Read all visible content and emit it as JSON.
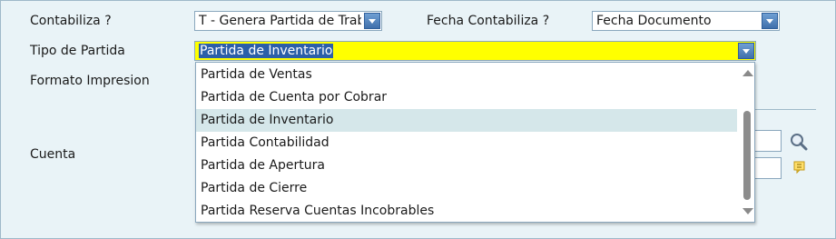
{
  "form": {
    "contabiliza_label": "Contabiliza ?",
    "contabiliza_value": "T - Genera Partida de Traba",
    "fecha_contabiliza_label": "Fecha Contabiliza ?",
    "fecha_contabiliza_value": "Fecha Documento",
    "tipo_partida_label": "Tipo de Partida",
    "tipo_partida_value": "Partida de Inventario",
    "formato_impresion_label": "Formato Impresion",
    "cuenta_label": "Cuenta"
  },
  "dropdown": {
    "selected_index": 2,
    "options": [
      "Partida de Ventas",
      "Partida de Cuenta por Cobrar",
      "Partida de Inventario",
      "Partida Contabilidad",
      "Partida de Apertura",
      "Partida de Cierre",
      "Partida Reserva Cuentas Incobrables"
    ]
  },
  "icons": {
    "lookup": "magnifier-icon",
    "note": "note-icon"
  },
  "colors": {
    "background": "#e9f3f7",
    "highlight_yellow": "#ffff00",
    "selection_blue": "#2c5fa8",
    "active_option": "#d5e7ea",
    "dropdown_button": "#3f6fab"
  }
}
